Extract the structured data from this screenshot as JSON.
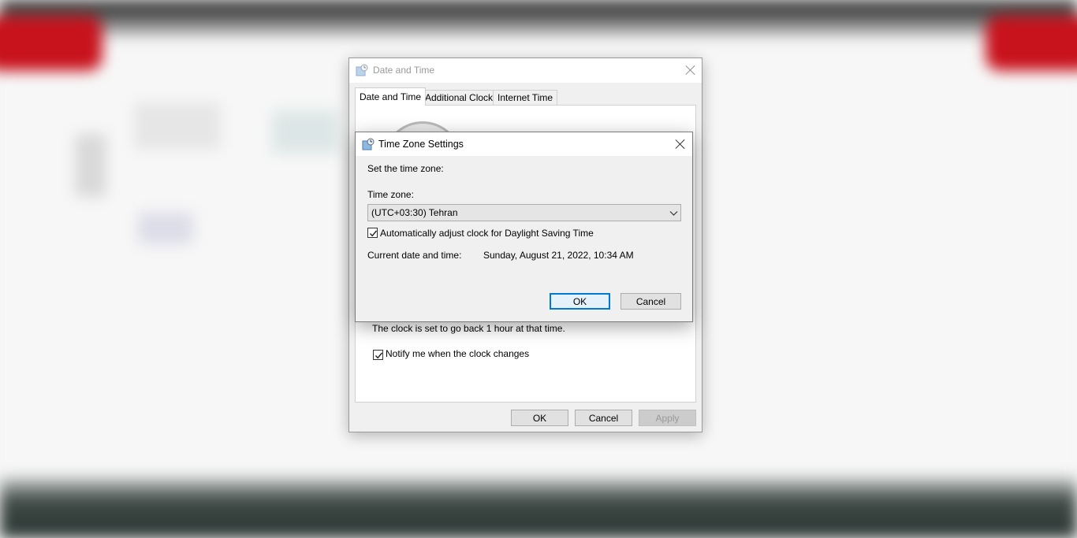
{
  "date_time_window": {
    "title": "Date and Time",
    "tabs": [
      "Date and Time",
      "Additional Clocks",
      "Internet Time"
    ],
    "dst_info": "The clock is set to go back 1 hour at that time.",
    "notify_label": "Notify me when the clock changes",
    "notify_checked": true,
    "buttons": {
      "ok": "OK",
      "cancel": "Cancel",
      "apply": "Apply"
    }
  },
  "time_zone_dialog": {
    "title": "Time Zone Settings",
    "instruction": "Set the time zone:",
    "time_zone_label": "Time zone:",
    "time_zone_value": "(UTC+03:30) Tehran",
    "auto_dst_label": "Automatically adjust clock for Daylight Saving Time",
    "auto_dst_checked": true,
    "current_label": "Current date and time:",
    "current_value": "Sunday, August 21, 2022, 10:34 AM",
    "buttons": {
      "ok": "OK",
      "cancel": "Cancel"
    }
  },
  "icons": [
    "clock-globe-icon",
    "close-icon",
    "chevron-down-icon",
    "checkmark-icon"
  ],
  "colors": {
    "accent": "#0078d7",
    "dialog_bg": "#f0f0f0"
  }
}
